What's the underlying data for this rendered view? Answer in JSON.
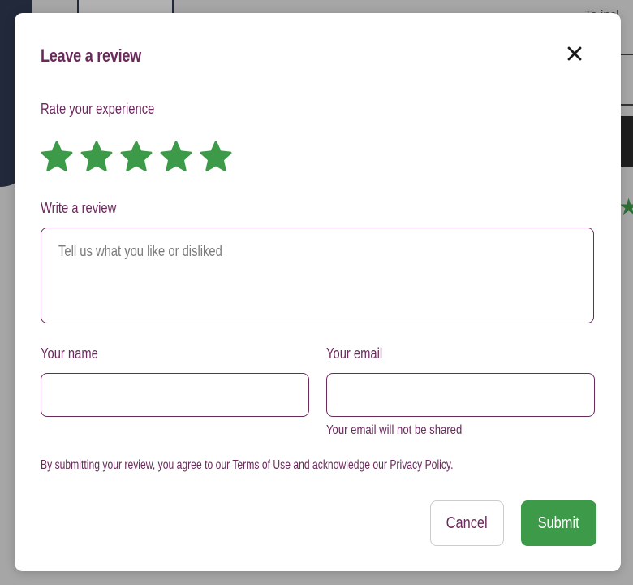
{
  "modal": {
    "title": "Leave a review",
    "close_icon": "close-icon",
    "rating": {
      "label": "Rate your experience",
      "value": 5,
      "max": 5,
      "star_color": "#3c9a49"
    },
    "review": {
      "label": "Write a review",
      "placeholder": "Tell us what you like or disliked",
      "value": ""
    },
    "name": {
      "label": "Your name",
      "value": ""
    },
    "email": {
      "label": "Your email",
      "value": "",
      "hint": "Your email will not be shared"
    },
    "legal_text": "By submitting your review, you agree to our Terms of Use and acknowledge our Privacy Policy.",
    "buttons": {
      "cancel": "Cancel",
      "submit": "Submit"
    }
  },
  "background": {
    "partial_text": "To incl"
  },
  "colors": {
    "accent_purple": "#6b2a5c",
    "submit_green": "#3c9a49"
  }
}
